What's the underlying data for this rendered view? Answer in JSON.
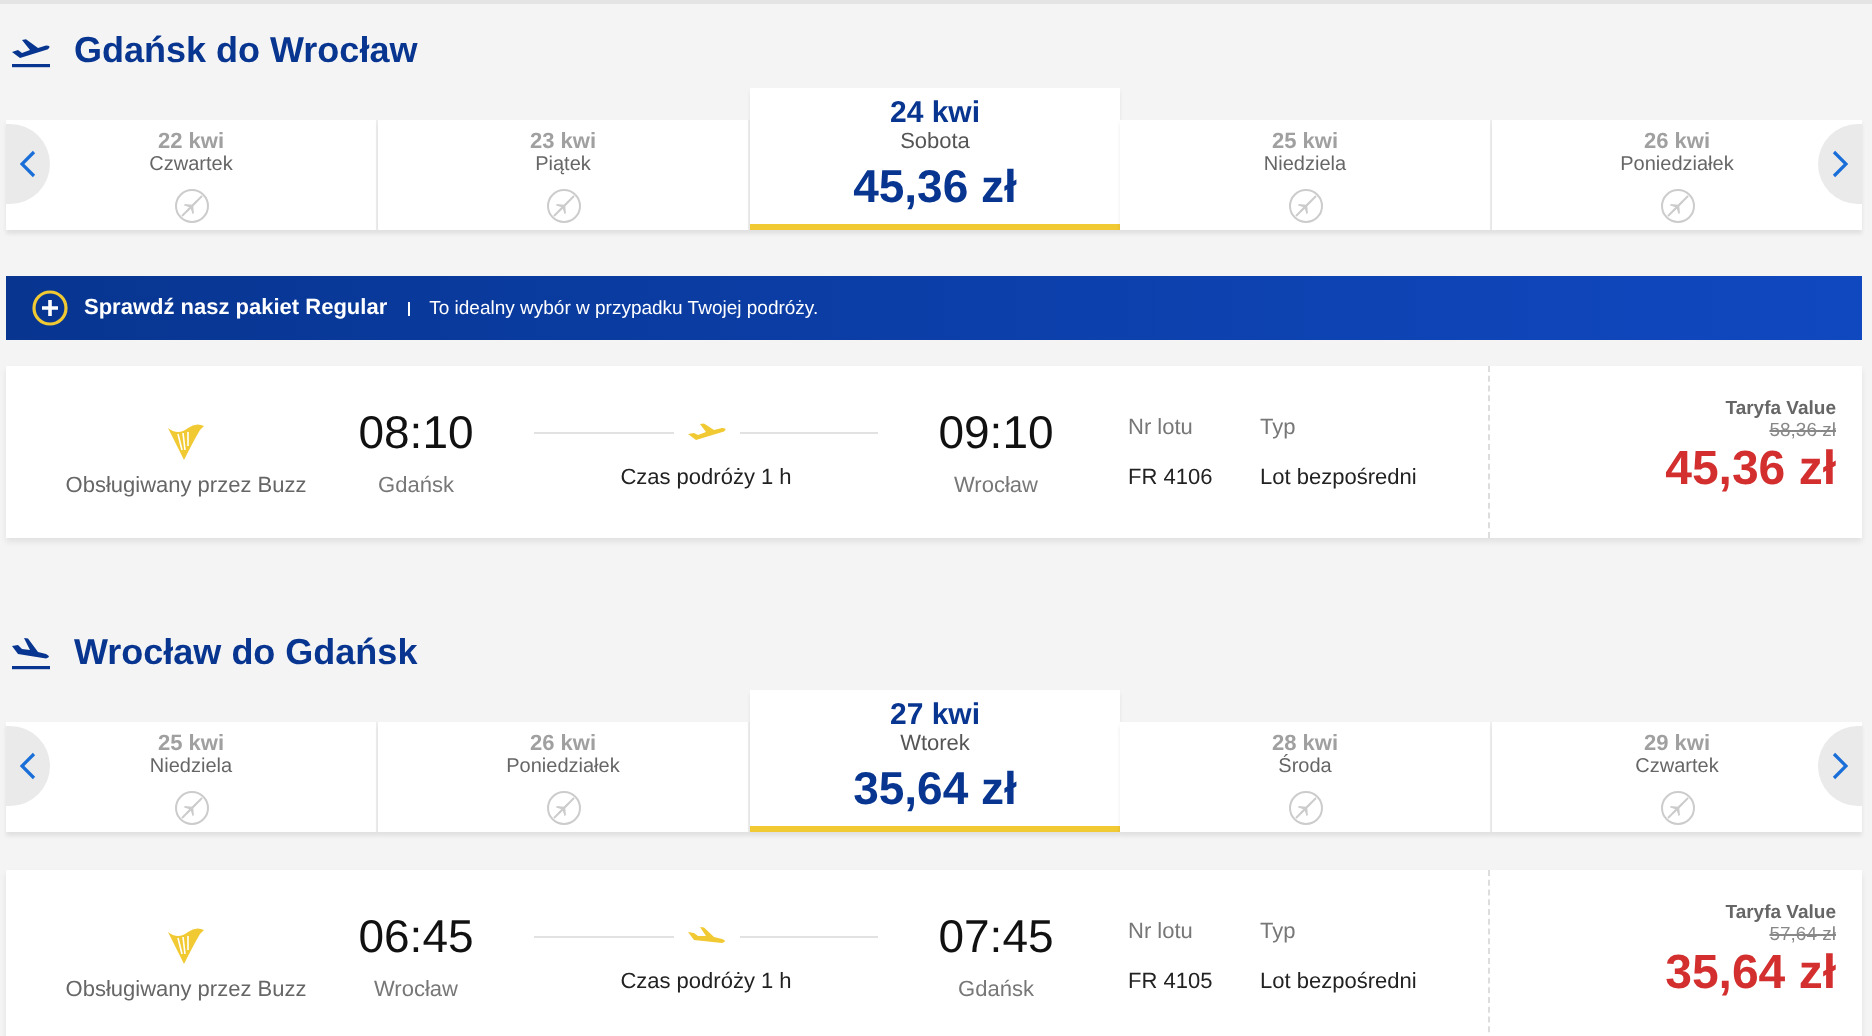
{
  "journeys": [
    {
      "title": "Gdańsk do Wrocław",
      "kind": "takeoff",
      "dates": [
        {
          "date": "22 kwi",
          "day": "Czwartek",
          "selected": false
        },
        {
          "date": "23 kwi",
          "day": "Piątek",
          "selected": false
        },
        {
          "date": "24 kwi",
          "day": "Sobota",
          "price": "45,36 zł",
          "selected": true
        },
        {
          "date": "25 kwi",
          "day": "Niedziela",
          "selected": false
        },
        {
          "date": "26 kwi",
          "day": "Poniedziałek",
          "selected": false
        }
      ],
      "banner": {
        "title": "Sprawdź nasz pakiet Regular",
        "text": "To idealny wybór w przypadku Twojej podróży."
      },
      "flight": {
        "operator": "Obsługiwany przez Buzz",
        "departure_time": "08:10",
        "departure_city": "Gdańsk",
        "duration": "Czas podróży 1 h",
        "arrival_time": "09:10",
        "arrival_city": "Wrocław",
        "flight_no_label": "Nr lotu",
        "flight_no": "FR 4106",
        "type_label": "Typ",
        "type": "Lot bezpośredni",
        "fare_name": "Taryfa Value",
        "old_price": "58,36 zł",
        "price": "45,36 zł"
      }
    },
    {
      "title": "Wrocław do Gdańsk",
      "kind": "landing",
      "dates": [
        {
          "date": "25 kwi",
          "day": "Niedziela",
          "selected": false
        },
        {
          "date": "26 kwi",
          "day": "Poniedziałek",
          "selected": false
        },
        {
          "date": "27 kwi",
          "day": "Wtorek",
          "price": "35,64 zł",
          "selected": true
        },
        {
          "date": "28 kwi",
          "day": "Środa",
          "selected": false
        },
        {
          "date": "29 kwi",
          "day": "Czwartek",
          "selected": false
        }
      ],
      "flight": {
        "operator": "Obsługiwany przez Buzz",
        "departure_time": "06:45",
        "departure_city": "Wrocław",
        "duration": "Czas podróży 1 h",
        "arrival_time": "07:45",
        "arrival_city": "Gdańsk",
        "flight_no_label": "Nr lotu",
        "flight_no": "FR 4105",
        "type_label": "Typ",
        "type": "Lot bezpośredni",
        "fare_name": "Taryfa Value",
        "old_price": "57,64 zł",
        "price": "35,64 zł"
      }
    }
  ]
}
